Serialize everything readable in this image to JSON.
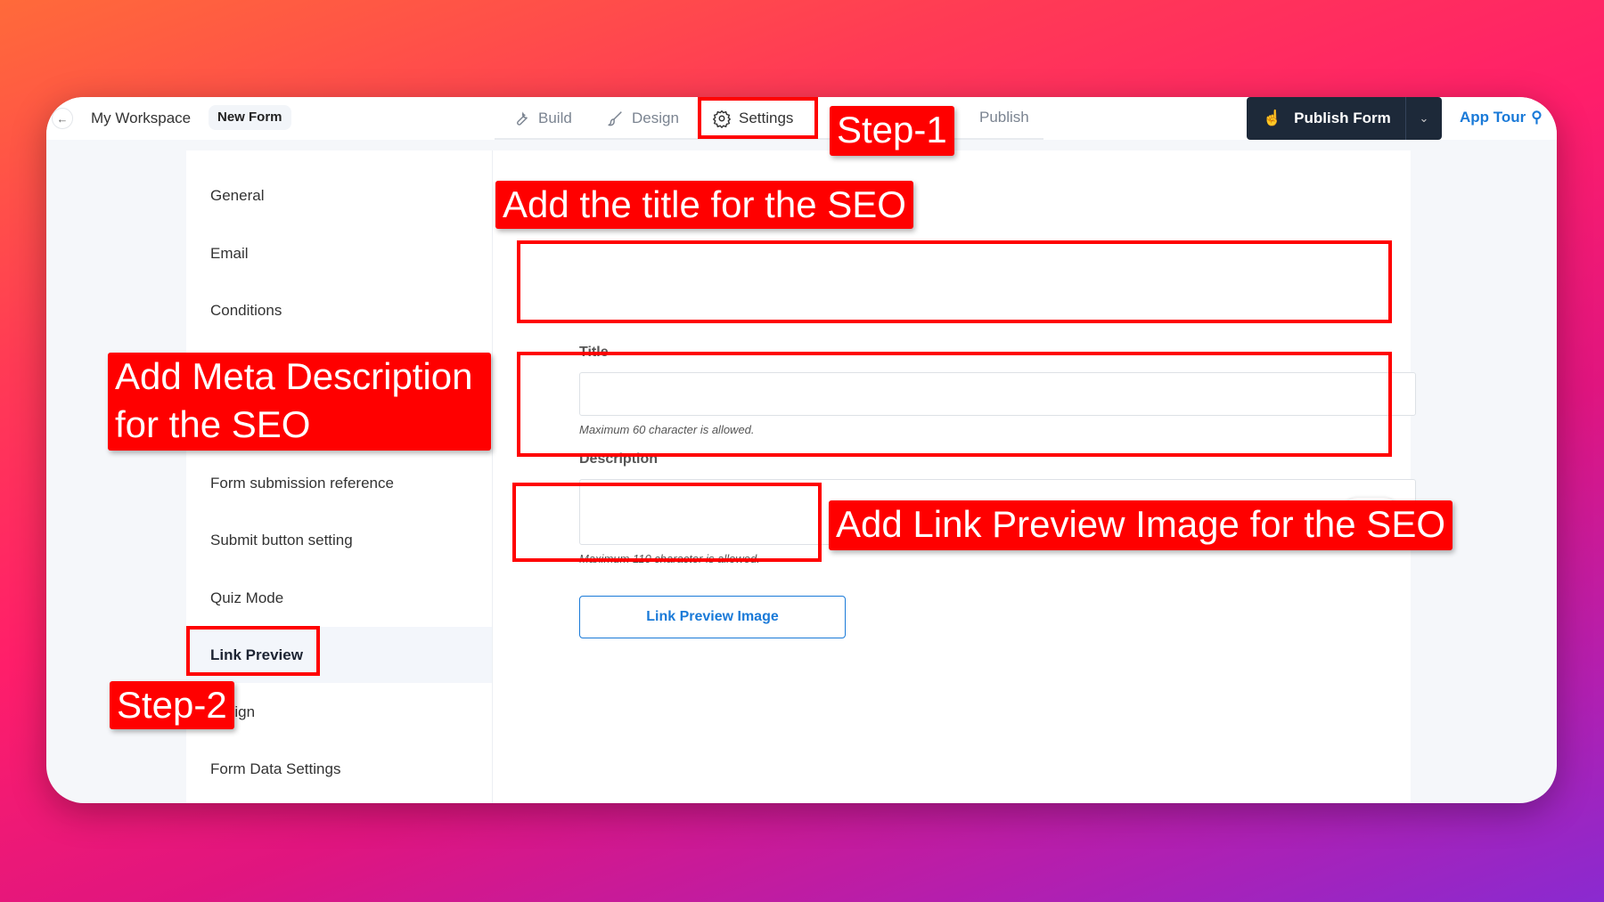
{
  "topbar": {
    "breadcrumb": [
      "My Workspace",
      "New Form"
    ],
    "tabs": [
      {
        "label": "Build",
        "icon": "wrench-icon"
      },
      {
        "label": "Design",
        "icon": "brush-icon"
      },
      {
        "label": "Settings",
        "icon": "gear-icon",
        "active": true
      },
      {
        "label": "Publish",
        "icon": "publish-icon"
      }
    ],
    "publish_button": "Publish Form",
    "app_tour": "App Tour"
  },
  "sidebar": {
    "items": [
      "General",
      "Email",
      "Conditions",
      "Form submission reference",
      "Submit button setting",
      "Quiz Mode",
      "Link Preview",
      "design",
      "Form Data Settings"
    ],
    "active": "Link Preview"
  },
  "main": {
    "title_label": "Title",
    "title_value": "",
    "title_hint": "Maximum 60 character is allowed.",
    "description_label": "Description",
    "description_value": "",
    "description_hint": "Maximum 110 character is allowed.",
    "link_preview_button": "Link Preview Image"
  },
  "annotations": {
    "step1": "Step-1",
    "step2": "Step-2",
    "title_note": "Add the title for the SEO",
    "desc_note_line1": "Add Meta Description",
    "desc_note_line2": "for the SEO",
    "image_note": "Add Link Preview Image for the SEO",
    "color": "#ff0000"
  }
}
